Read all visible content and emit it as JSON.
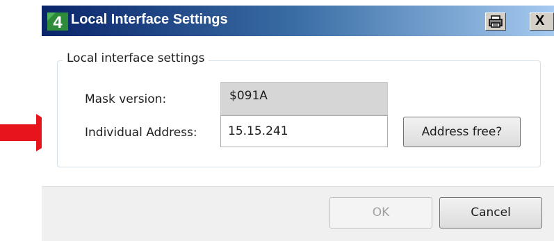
{
  "window": {
    "title": "Local Interface Settings",
    "app_icon_glyph": "4",
    "app_icon": "knx-app-icon",
    "print_icon": "printer-icon",
    "close_glyph": "X",
    "close_icon": "close-icon"
  },
  "group": {
    "legend": "Local interface settings",
    "mask_label": "Mask version:",
    "mask_value": "$091A",
    "address_label": "Individual Address:",
    "address_value": "15.15.241",
    "address_free_label": "Address free?"
  },
  "footer": {
    "ok_label": "OK",
    "cancel_label": "Cancel"
  },
  "annotation": {
    "icon": "red-arrow-icon",
    "color": "#e8141c"
  },
  "colors": {
    "titlebar_start": "#0a246a",
    "titlebar_end": "#a6caf0",
    "app_icon_green": "#2e8b3a"
  }
}
